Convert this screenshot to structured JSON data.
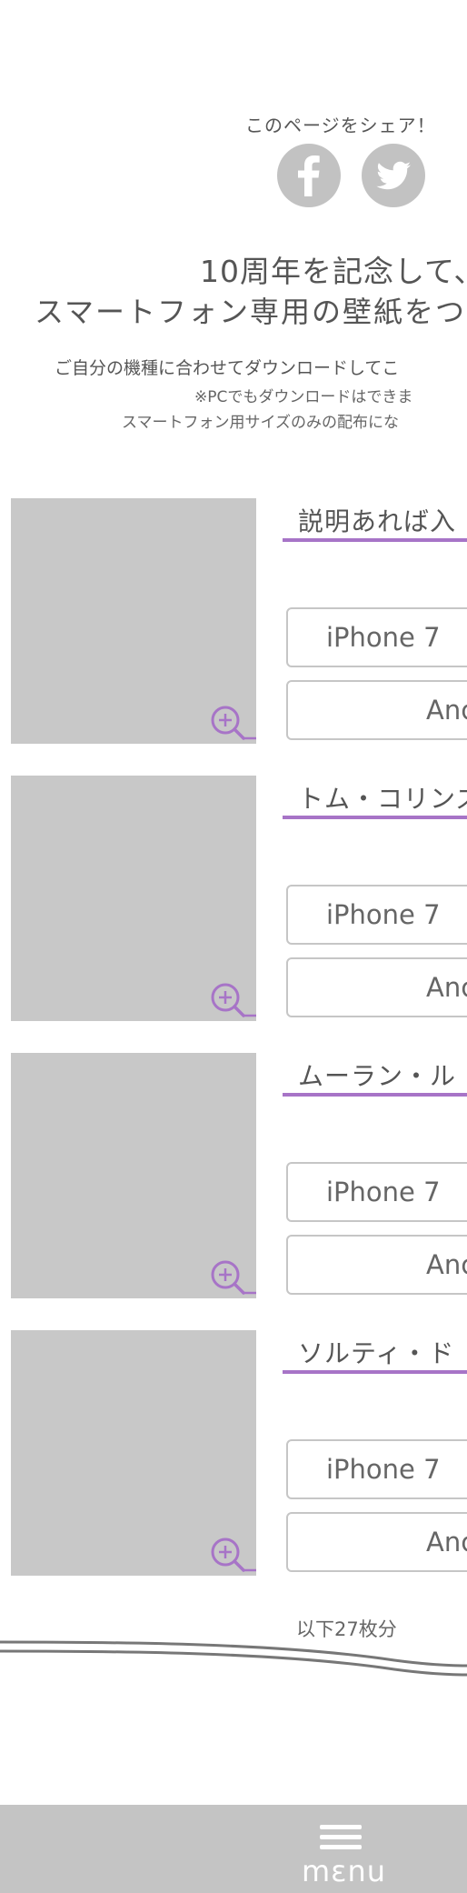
{
  "share": {
    "title": "このページをシェア！",
    "facebook_icon": "facebook-icon",
    "twitter_icon": "twitter-icon",
    "icon_color": "#c2c2c2"
  },
  "intro": {
    "headline_1": "10周年を記念して、",
    "headline_2": "スマートフォン専用の壁紙をつ",
    "lead": "ご自分の機種に合わせてダウンロードしてこ",
    "note_1": "※PCでもダウンロードはできま",
    "note_2": "スマートフォン用サイズのみの配布にな"
  },
  "accent_color": "#a774c7",
  "items": [
    {
      "title": "説明あれば入",
      "iphone_label": "iPhone 7",
      "android_label": "Anc"
    },
    {
      "title": "トム・コリンズ",
      "iphone_label": "iPhone 7",
      "android_label": "Anc"
    },
    {
      "title": "ムーラン・ル",
      "iphone_label": "iPhone 7",
      "android_label": "Anc"
    },
    {
      "title": "ソルティ・ド",
      "iphone_label": "iPhone 7",
      "android_label": "Anc"
    }
  ],
  "more_text": "以下27枚分",
  "menu": {
    "label": "mεnu",
    "icon": "hamburger-menu-icon"
  }
}
